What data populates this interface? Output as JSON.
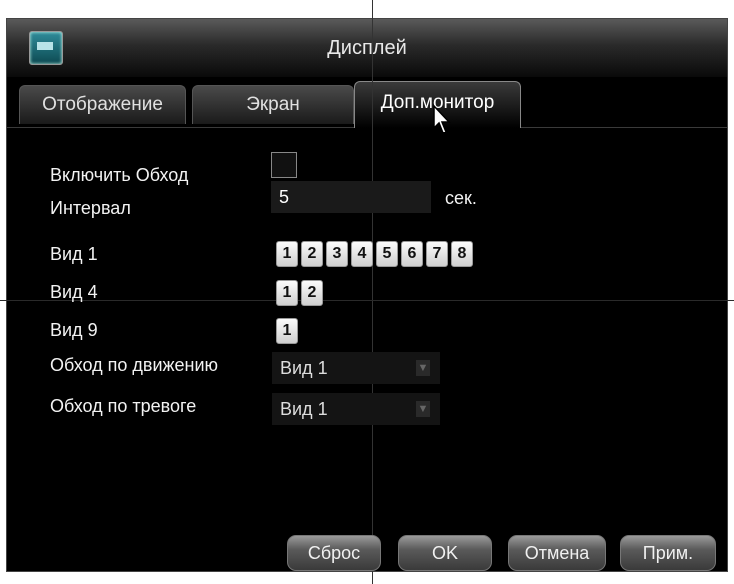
{
  "window": {
    "title": "Дисплей",
    "icon": "monitor-icon"
  },
  "tabs": [
    {
      "label": "Отображение",
      "active": false
    },
    {
      "label": "Экран",
      "active": false
    },
    {
      "label": "Доп.монитор",
      "active": true
    }
  ],
  "form": {
    "enable_label": "Включить Обход",
    "enable_checked": false,
    "interval_label": "Интервал",
    "interval_value": "5",
    "interval_unit": "сек.",
    "view1_label": "Вид 1",
    "view1_buttons": [
      "1",
      "2",
      "3",
      "4",
      "5",
      "6",
      "7",
      "8"
    ],
    "view4_label": "Вид 4",
    "view4_buttons": [
      "1",
      "2"
    ],
    "view9_label": "Вид 9",
    "view9_buttons": [
      "1"
    ],
    "motion_label": "Обход по движению",
    "motion_value": "Вид 1",
    "alarm_label": "Обход по тревоге",
    "alarm_value": "Вид 1"
  },
  "buttons": {
    "reset": "Сброс",
    "ok": "OK",
    "cancel": "Отмена",
    "apply": "Прим."
  }
}
